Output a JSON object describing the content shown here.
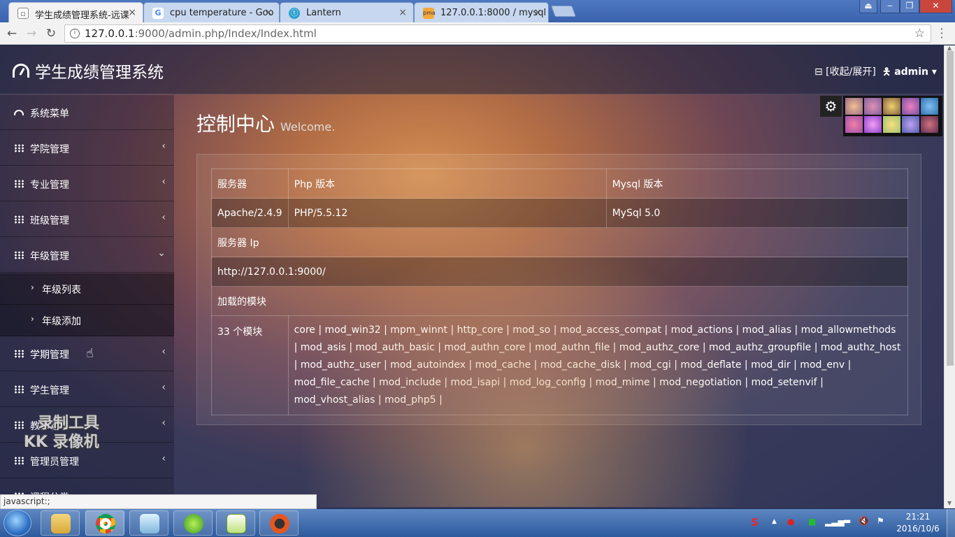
{
  "browser": {
    "tabs": [
      {
        "title": "学生成绩管理系统-远课",
        "icon": "page-icon",
        "active": true
      },
      {
        "title": "cpu temperature - Goo",
        "icon": "google-icon",
        "active": false
      },
      {
        "title": "Lantern",
        "icon": "lantern-icon",
        "active": false
      },
      {
        "title": "127.0.0.1:8000 / mysql",
        "icon": "phpmyadmin-icon",
        "active": false
      }
    ],
    "url_host": "127.0.0.1",
    "url_rest": ":9000/admin.php/Index/Index.html",
    "status_text": "javascript:;"
  },
  "app": {
    "brand": "学生成绩管理系统",
    "toggle_label": "⊟ [收起/展开]",
    "user_label": "admin"
  },
  "sidebar": {
    "items": [
      {
        "label": "系统菜单",
        "icon": "dashboard-icon",
        "chevron": ""
      },
      {
        "label": "学院管理",
        "icon": "grid-icon",
        "chevron": "‹"
      },
      {
        "label": "专业管理",
        "icon": "grid-icon",
        "chevron": "‹"
      },
      {
        "label": "班级管理",
        "icon": "grid-icon",
        "chevron": "‹"
      },
      {
        "label": "年级管理",
        "icon": "grid-icon",
        "chevron": "⌄"
      },
      {
        "label": "学期管理",
        "icon": "grid-icon",
        "chevron": "‹"
      },
      {
        "label": "学生管理",
        "icon": "grid-icon",
        "chevron": "‹"
      },
      {
        "label": "教师管理",
        "icon": "grid-icon",
        "chevron": "‹"
      },
      {
        "label": "管理员管理",
        "icon": "grid-icon",
        "chevron": "‹"
      },
      {
        "label": "课程分类",
        "icon": "grid-icon",
        "chevron": ""
      }
    ],
    "subitems": [
      {
        "label": "年级列表"
      },
      {
        "label": "年级添加"
      }
    ]
  },
  "main": {
    "title": "控制中心",
    "subtitle": "Welcome."
  },
  "info_table": {
    "header": [
      "服务器",
      "Php 版本",
      "Mysql 版本"
    ],
    "values": [
      "Apache/2.4.9",
      "PHP/5.5.12",
      "MySql 5.0"
    ],
    "ip_label": "服务器 Ip",
    "ip_value": "http://127.0.0.1:9000/",
    "modules_label": "加载的模块",
    "modules_count": "33 个模块",
    "modules_list": "core | mod_win32 | mpm_winnt | http_core | mod_so | mod_access_compat | mod_actions | mod_alias | mod_allowmethods | mod_asis | mod_auth_basic | mod_authn_core | mod_authn_file | mod_authz_core | mod_authz_groupfile | mod_authz_host | mod_authz_user | mod_autoindex | mod_cache | mod_cache_disk | mod_cgi | mod_deflate | mod_dir | mod_env | mod_file_cache | mod_include | mod_isapi | mod_log_config | mod_mime | mod_negotiation | mod_setenvif | mod_vhost_alias | mod_php5 |"
  },
  "watermark": {
    "line1": "录制工具",
    "line2": "KK 录像机"
  },
  "theme_colors": [
    "#d9a070",
    "#c8849a",
    "#d6b060",
    "#c47aa8",
    "#6ca4d8",
    "#d86a8a",
    "#c45ac8",
    "#e8c070",
    "#8a8ad0",
    "#b06070"
  ],
  "taskbar": {
    "time": "21:21",
    "date": "2016/10/6",
    "apps": [
      "explorer-icon",
      "chrome-icon",
      "notepad-icon",
      "lantern-icon",
      "notepadpp-icon",
      "recorder-icon"
    ]
  }
}
